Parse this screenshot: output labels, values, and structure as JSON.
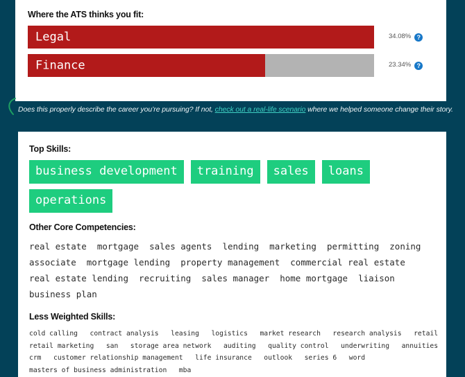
{
  "theme": {
    "page_background": "#034158",
    "card_background": "#ffffff",
    "bar_fill": "#b21a1a",
    "bar_track": "#b3b3b3",
    "tag_green": "#1ecd7f",
    "help_blue": "#1878c8",
    "link_teal": "#3fd1c4",
    "arrow_green": "#1e9e62"
  },
  "fit_section": {
    "heading": "Where the ATS thinks you fit:",
    "bars": [
      {
        "label": "Legal",
        "percent_text": "34.08%",
        "percent_value": 34.08,
        "fill_ratio": 1.0,
        "help_icon": "help-circle-icon",
        "help_glyph": "?"
      },
      {
        "label": "Finance",
        "percent_text": "23.34%",
        "percent_value": 23.34,
        "fill_ratio": 0.685,
        "help_icon": "help-circle-icon",
        "help_glyph": "?"
      }
    ]
  },
  "footnote": {
    "text_before": "Does this properly describe the career you’re pursuing? If not, ",
    "link_text": "check out a real-life scenario",
    "text_after": " where we helped someone change their story.",
    "arrow_icon": "curved-arrow-icon"
  },
  "skills_section": {
    "top_skills": {
      "heading": "Top Skills:",
      "tags": [
        "business development",
        "training",
        "sales",
        "loans",
        "operations"
      ]
    },
    "core_competencies": {
      "heading": "Other Core Competencies:",
      "lines": [
        "real estate  mortgage  sales agents  lending  marketing  permitting  zoning",
        "associate  mortgage lending  property management  commercial real estate",
        "real estate lending  recruiting  sales manager  home mortgage  liaison",
        "business plan"
      ]
    },
    "less_weighted": {
      "heading": "Less Weighted Skills:",
      "lines": [
        "cold calling   contract analysis   leasing   logistics   market research   research analysis   retail",
        "retail marketing   san   storage area network   auditing   quality control   underwriting   annuities",
        "crm   customer relationship management   life insurance   outlook   series 6   word",
        "masters of business administration   mba"
      ]
    }
  }
}
